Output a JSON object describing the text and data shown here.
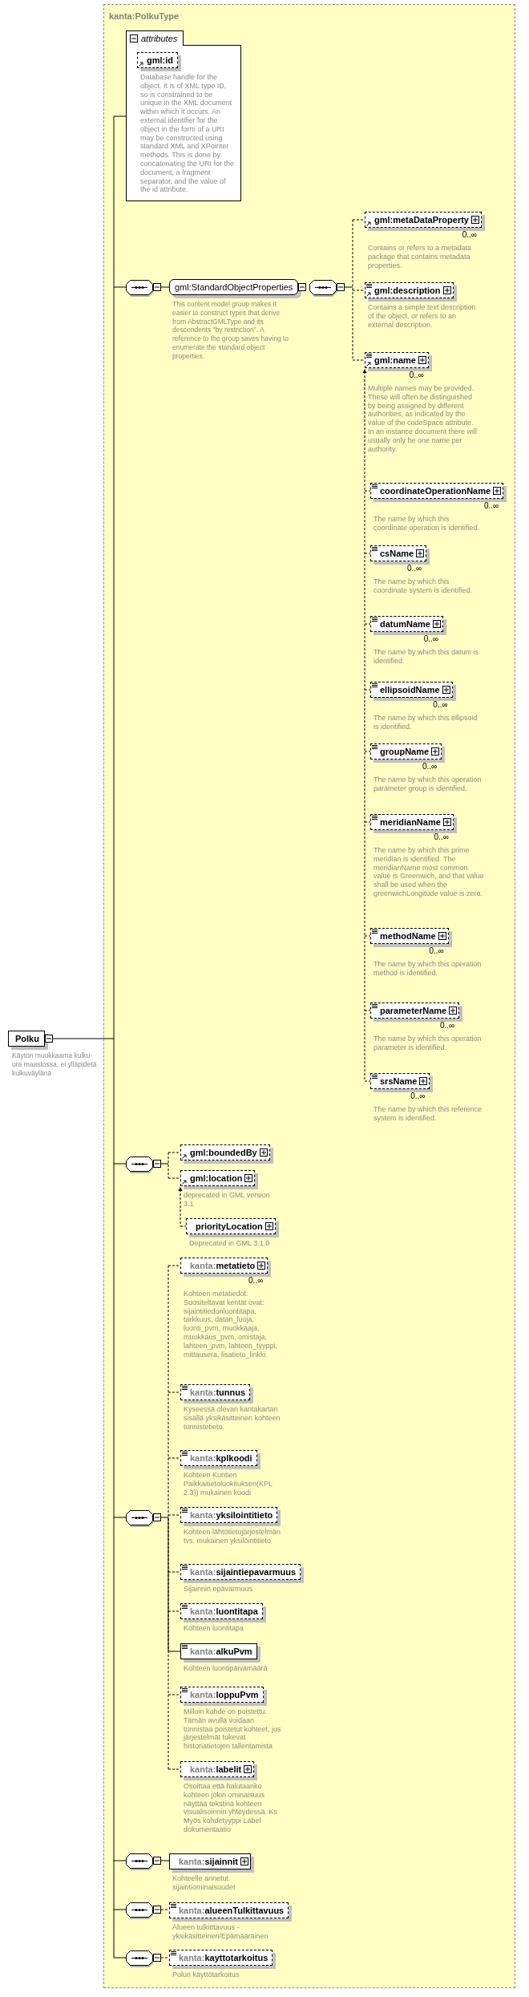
{
  "element": {
    "name": "Polku",
    "expanded": true,
    "description": "Käytön muokkaama kulku-ura maastossa, ei ylläpidetä kulkuväylänä"
  },
  "type": {
    "title": "kanta:PolkuType",
    "attributes": {
      "label": "attributes",
      "expanded": true,
      "items": [
        {
          "kind": "element",
          "name": "gml:id",
          "optional": true,
          "ref": true,
          "simple": false,
          "expandable": false,
          "description": "Database handle for the object.  It is of XML type ID, so is constrained to be unique in the XML document within which it occurs.  An external identifier for the object in the form of a URI may be constructed using standard XML and XPointer methods.  This is done by concatenating the URI for the document, a fragment separator, and the value of the id attribute."
        }
      ]
    },
    "sequences": [
      {
        "expanded": true,
        "items": [
          {
            "kind": "group",
            "name": "gml:StandardObjectProperties",
            "expanded": true,
            "description": "This content model group makes it easier to construct types that derive from AbstractGMLType and its descendents \"by restriction\".  A reference to the group saves having to enumerate the standard object properties.",
            "sequence": {
              "expanded": true,
              "items": [
                {
                  "kind": "element",
                  "name": "gml:metaDataProperty",
                  "optional": true,
                  "ref": true,
                  "simple": false,
                  "expandable": true,
                  "occurs": "0..∞",
                  "description": "Contains or refers to a metadata package that contains metadata properties."
                },
                {
                  "kind": "element",
                  "name": "gml:description",
                  "optional": true,
                  "ref": true,
                  "simple": true,
                  "expandable": true,
                  "description": "Contains a simple text description of the object, or refers to an external description."
                },
                {
                  "kind": "element",
                  "name": "gml:name",
                  "optional": true,
                  "ref": true,
                  "simple": true,
                  "expandable": true,
                  "occurs": "0..∞",
                  "description": "Multiple names may be provided.  These will often be distinguished by being assigned by different authorities, as indicated by the value of the codeSpace attribute.  In an instance document there will usually only be one name per authority.",
                  "substitutes": [
                    {
                      "kind": "element",
                      "name": "coordinateOperationName",
                      "optional": true,
                      "ref": false,
                      "simple": true,
                      "expandable": true,
                      "occurs": "0..∞",
                      "description": "The name by which this coordinate operation is identified."
                    },
                    {
                      "kind": "element",
                      "name": "csName",
                      "optional": true,
                      "ref": false,
                      "simple": true,
                      "expandable": true,
                      "occurs": "0..∞",
                      "description": "The name by which this coordinate system is identified."
                    },
                    {
                      "kind": "element",
                      "name": "datumName",
                      "optional": true,
                      "ref": false,
                      "simple": true,
                      "expandable": true,
                      "occurs": "0..∞",
                      "description": "The name by which this datum is identified."
                    },
                    {
                      "kind": "element",
                      "name": "ellipsoidName",
                      "optional": true,
                      "ref": false,
                      "simple": true,
                      "expandable": true,
                      "occurs": "0..∞",
                      "description": "The name by which this ellipsoid is identified."
                    },
                    {
                      "kind": "element",
                      "name": "groupName",
                      "optional": true,
                      "ref": false,
                      "simple": true,
                      "expandable": true,
                      "occurs": "0..∞",
                      "description": "The name by which this operation parameter group is identified."
                    },
                    {
                      "kind": "element",
                      "name": "meridianName",
                      "optional": true,
                      "ref": false,
                      "simple": true,
                      "expandable": true,
                      "occurs": "0..∞",
                      "description": "The name by which this prime meridian is identified. The meridianName most common value is Greenwich, and that value shall be used when the greenwichLongitude value is zero."
                    },
                    {
                      "kind": "element",
                      "name": "methodName",
                      "optional": true,
                      "ref": false,
                      "simple": true,
                      "expandable": true,
                      "occurs": "0..∞",
                      "description": "The name by which this operation method is identified."
                    },
                    {
                      "kind": "element",
                      "name": "parameterName",
                      "optional": true,
                      "ref": false,
                      "simple": true,
                      "expandable": true,
                      "occurs": "0..∞",
                      "description": "The name by which this operation parameter is identified."
                    },
                    {
                      "kind": "element",
                      "name": "srsName",
                      "optional": true,
                      "ref": false,
                      "simple": true,
                      "expandable": true,
                      "occurs": "0..∞",
                      "description": "The name by which this reference system is identified."
                    }
                  ]
                }
              ]
            }
          }
        ]
      },
      {
        "expanded": true,
        "items": [
          {
            "kind": "element",
            "name": "gml:boundedBy",
            "optional": true,
            "ref": true,
            "simple": false,
            "expandable": true
          },
          {
            "kind": "element",
            "name": "gml:location",
            "optional": true,
            "ref": true,
            "simple": false,
            "expandable": true,
            "description": "deprecated in GML version 3.1",
            "substitutes": [
              {
                "kind": "element",
                "name": "priorityLocation",
                "optional": true,
                "ref": false,
                "simple": false,
                "expandable": true,
                "description": "Deprecated in GML 3.1.0"
              }
            ]
          }
        ]
      },
      {
        "expanded": true,
        "items": [
          {
            "kind": "element",
            "prefix": "kanta:",
            "name": "metatieto",
            "optional": true,
            "ref": false,
            "simple": false,
            "expandable": true,
            "occurs": "0..∞",
            "description": "Kohteen metatiedot. Suositeltavat kentät ovat: sijaintitiedonluontitapa, tarkkuus, datan_luoja, luonti_pvm, muokkaaja, muokkaus_pvm, omistaja, lahteen_pvm, lahteen_tyyppi, mittausera, lisatieto_linkki"
          },
          {
            "kind": "element",
            "prefix": "kanta:",
            "name": "tunnus",
            "optional": true,
            "ref": false,
            "simple": true,
            "expandable": false,
            "description": "Kyseessä olevan kantakartan sisällä yksikäsitteinen kohteen tunnistetieto."
          },
          {
            "kind": "element",
            "prefix": "kanta:",
            "name": "kplkoodi",
            "optional": true,
            "ref": false,
            "simple": true,
            "expandable": false,
            "description": "Kohteen Kuntien Paikkaitietoluokituksen(KPL 2.3)) mukainen koodi"
          },
          {
            "kind": "element",
            "prefix": "kanta:",
            "name": "yksilointitieto",
            "optional": true,
            "ref": false,
            "simple": true,
            "expandable": false,
            "description": "Kohteen lähtötietojärjestelmän  tvs. mukainen yksilöintitieto"
          },
          {
            "kind": "element",
            "prefix": "kanta:",
            "name": "sijaintiepavarmuus",
            "optional": true,
            "ref": false,
            "simple": true,
            "expandable": false,
            "description": "Sijainnin epävarmuus"
          },
          {
            "kind": "element",
            "prefix": "kanta:",
            "name": "luontitapa",
            "optional": true,
            "ref": false,
            "simple": true,
            "expandable": false,
            "description": "Kohteen luontitapa"
          },
          {
            "kind": "element",
            "prefix": "kanta:",
            "name": "alkuPvm",
            "optional": false,
            "ref": false,
            "simple": true,
            "expandable": false,
            "description": "Kohteen luontipäivämäärä"
          },
          {
            "kind": "element",
            "prefix": "kanta:",
            "name": "loppuPvm",
            "optional": true,
            "ref": false,
            "simple": true,
            "expandable": false,
            "description": "Milloin kohde on poistettu. Tämän avulla voidaan tunnistaa poistetut kohteet, jos järjestelmät tukevat historiatietojen tallentamista"
          },
          {
            "kind": "element",
            "prefix": "kanta:",
            "name": "labelit",
            "optional": true,
            "ref": false,
            "simple": false,
            "expandable": true,
            "description": "Osoittaa että halutaanko kohteen jokin ominaisuus näyttää tekstinä kohteen visualisoinnin yhteydessä.  Ks Myös kohdetyyppi Label dokumentaatio"
          }
        ]
      },
      {
        "expanded": true,
        "items": [
          {
            "kind": "element",
            "prefix": "kanta:",
            "name": "sijainnit",
            "optional": false,
            "ref": false,
            "simple": false,
            "expandable": true,
            "description": "Kohteelle annetut sijaintiominaisuudet"
          }
        ]
      },
      {
        "expanded": true,
        "items": [
          {
            "kind": "element",
            "prefix": "kanta:",
            "name": "alueenTulkittavuus",
            "optional": true,
            "ref": false,
            "simple": true,
            "expandable": false,
            "description": "Alueen tulkitttavuus - yksikäsitteinen/Epämääräinen"
          }
        ]
      },
      {
        "expanded": true,
        "items": [
          {
            "kind": "element",
            "prefix": "kanta:",
            "name": "kayttotarkoitus",
            "optional": true,
            "ref": false,
            "simple": true,
            "expandable": false,
            "description": "Polun käyttötarkoitus"
          }
        ]
      }
    ]
  }
}
